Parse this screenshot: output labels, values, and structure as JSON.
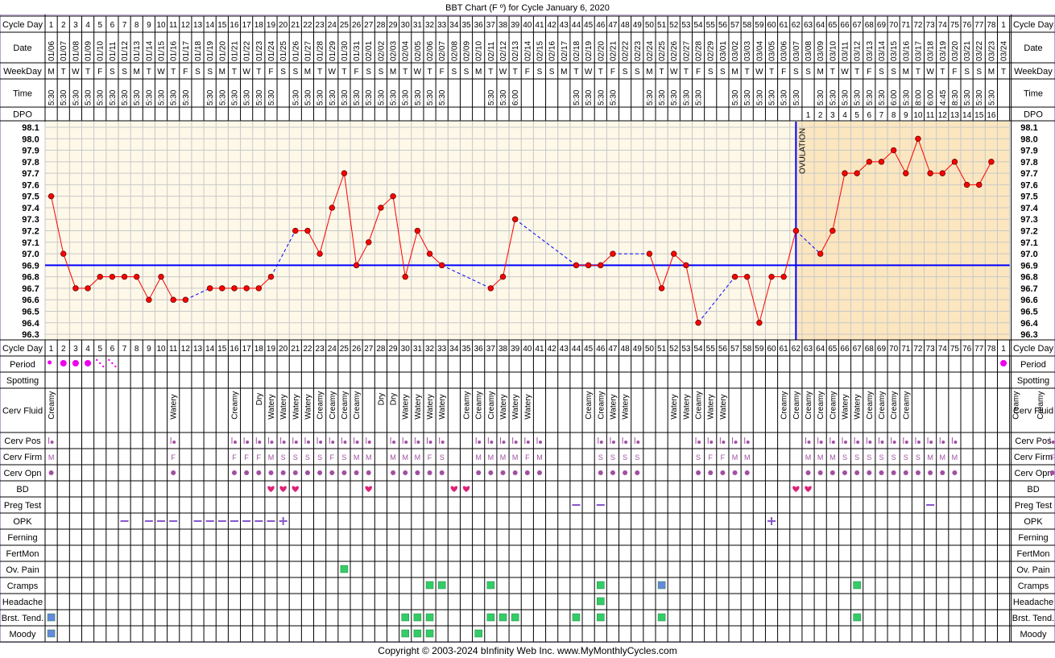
{
  "title": "BBT Chart (F º) for Cycle January 6, 2020",
  "footer": "Copyright © 2003-2024 bInfinity Web Inc.     www.MyMonthlyCycles.com",
  "colors": {
    "frame": "#b9a3d6",
    "chart_bg_pre": "#fdf8e8",
    "chart_bg_post": "#fbe6bf",
    "temp_line": "#ff0000",
    "coverline": "#0000ff",
    "period": "#ee00ee",
    "heart": "#dd2277",
    "symptom": "#33cc66",
    "symptom_alt": "#6688dd",
    "opk": "#8855cc",
    "cerv": "#a050a0"
  },
  "labels": {
    "cycle_day": "Cycle Day",
    "date": "Date",
    "weekday": "WeekDay",
    "time": "Time",
    "dpo": "DPO",
    "period": "Period",
    "spotting": "Spotting",
    "cerv_fluid": "Cerv Fluid",
    "cerv_pos": "Cerv Pos",
    "cerv_firm": "Cerv Firm",
    "cerv_opn": "Cerv Opn",
    "bd": "BD",
    "preg_test": "Preg Test",
    "opk": "OPK",
    "ferning": "Ferning",
    "fertmon": "FertMon",
    "ov_pain": "Ov. Pain",
    "cramps": "Cramps",
    "headache": "Headache",
    "brst_tend": "Brst. Tend.",
    "moody": "Moody",
    "ovulation": "OVULATION"
  },
  "chart_data": {
    "type": "line",
    "title": "BBT Chart (F º) for Cycle January 6, 2020",
    "xlabel": "Cycle Day",
    "ylabel": "",
    "ylim": [
      96.3,
      98.1
    ],
    "y_ticks": [
      "98.1",
      "98.0",
      "97.9",
      "97.8",
      "97.7",
      "97.6",
      "97.5",
      "97.4",
      "97.3",
      "97.2",
      "97.1",
      "97.0",
      "96.9",
      "96.8",
      "96.7",
      "96.6",
      "96.5",
      "96.4",
      "96.3"
    ],
    "grid": true,
    "cycle_days": [
      1,
      2,
      3,
      4,
      5,
      6,
      7,
      8,
      9,
      10,
      11,
      12,
      13,
      14,
      15,
      16,
      17,
      18,
      19,
      20,
      21,
      22,
      23,
      24,
      25,
      26,
      27,
      28,
      29,
      30,
      31,
      32,
      33,
      34,
      35,
      36,
      37,
      38,
      39,
      40,
      41,
      42,
      43,
      44,
      45,
      46,
      47,
      48,
      49,
      50,
      51,
      52,
      53,
      54,
      55,
      56,
      57,
      58,
      59,
      60,
      61,
      62,
      63,
      64,
      65,
      66,
      67,
      68,
      69,
      70,
      71,
      72,
      73,
      74,
      75,
      76,
      77,
      78
    ],
    "next_cycle_day": "1",
    "dates": [
      "01/06",
      "01/07",
      "01/08",
      "01/09",
      "01/10",
      "01/11",
      "01/12",
      "01/13",
      "01/14",
      "01/15",
      "01/16",
      "01/17",
      "01/18",
      "01/19",
      "01/20",
      "01/21",
      "01/22",
      "01/23",
      "01/24",
      "01/25",
      "01/26",
      "01/27",
      "01/28",
      "01/29",
      "01/30",
      "01/31",
      "02/01",
      "02/02",
      "02/03",
      "02/04",
      "02/05",
      "02/06",
      "02/07",
      "02/08",
      "02/09",
      "02/10",
      "02/11",
      "02/12",
      "02/13",
      "02/14",
      "02/15",
      "02/16",
      "02/17",
      "02/18",
      "02/19",
      "02/20",
      "02/21",
      "02/22",
      "02/23",
      "02/24",
      "02/25",
      "02/26",
      "02/27",
      "02/28",
      "02/29",
      "03/01",
      "03/02",
      "03/03",
      "03/04",
      "03/05",
      "03/06",
      "03/07",
      "03/08",
      "03/09",
      "03/10",
      "03/11",
      "03/12",
      "03/13",
      "03/14",
      "03/15",
      "03/16",
      "03/17",
      "03/18",
      "03/19",
      "03/20",
      "03/21",
      "03/22",
      "03/23",
      "03/24"
    ],
    "weekdays": [
      "M",
      "T",
      "W",
      "T",
      "F",
      "S",
      "S",
      "M",
      "T",
      "W",
      "T",
      "F",
      "S",
      "S",
      "M",
      "T",
      "W",
      "T",
      "F",
      "S",
      "S",
      "M",
      "T",
      "W",
      "T",
      "F",
      "S",
      "S",
      "M",
      "T",
      "W",
      "T",
      "F",
      "S",
      "S",
      "M",
      "T",
      "W",
      "T",
      "F",
      "S",
      "S",
      "M",
      "T",
      "W",
      "T",
      "F",
      "S",
      "S",
      "M",
      "T",
      "W",
      "T",
      "F",
      "S",
      "S",
      "M",
      "T",
      "W",
      "T",
      "F",
      "S",
      "S",
      "M",
      "T",
      "W",
      "T",
      "F",
      "S",
      "S",
      "M",
      "T",
      "W",
      "T",
      "F",
      "S",
      "S",
      "M",
      "T"
    ],
    "times": [
      "5:30",
      "5:30",
      "5:30",
      "5:30",
      "5:30",
      "5:30",
      "5:30",
      "5:30",
      "5:30",
      "5:30",
      "5:30",
      "5:30",
      "",
      "5:30",
      "5:30",
      "5:30",
      "5:30",
      "5:30",
      "5:30",
      "",
      "5:30",
      "5:30",
      "5:30",
      "5:30",
      "5:30",
      "5:30",
      "5:30",
      "5:30",
      "5:30",
      "5:30",
      "5:30",
      "5:30",
      "5:30",
      "",
      "",
      "",
      "5:30",
      "5:30",
      "6:00",
      "",
      "",
      "",
      "",
      "5:30",
      "5:30",
      "5:30",
      "5:30",
      "",
      "",
      "5:30",
      "5:30",
      "5:30",
      "5:30",
      "5:30",
      "",
      "",
      "5:30",
      "5:30",
      "5:30",
      "5:30",
      "5:30",
      "5:30",
      "",
      "5:30",
      "5:30",
      "5:30",
      "5:30",
      "5:30",
      "5:30",
      "6:00",
      "5:30",
      "8:00",
      "6:00",
      "4:45",
      "8:30",
      "5:30",
      "5:30",
      "5:30"
    ],
    "dpo": [
      "",
      "",
      "",
      "",
      "",
      "",
      "",
      "",
      "",
      "",
      "",
      "",
      "",
      "",
      "",
      "",
      "",
      "",
      "",
      "",
      "",
      "",
      "",
      "",
      "",
      "",
      "",
      "",
      "",
      "",
      "",
      "",
      "",
      "",
      "",
      "",
      "",
      "",
      "",
      "",
      "",
      "",
      "",
      "",
      "",
      "",
      "",
      "",
      "",
      "",
      "",
      "",
      "",
      "",
      "",
      "",
      "",
      "",
      "",
      "",
      "",
      "",
      "1",
      "2",
      "3",
      "4",
      "5",
      "6",
      "7",
      "8",
      "9",
      "10",
      "11",
      "12",
      "13",
      "14",
      "15",
      "16"
    ],
    "series": [
      {
        "values": [
          97.5,
          97.0,
          96.7,
          96.7,
          96.8,
          96.8,
          96.8,
          96.8,
          96.6,
          96.8,
          96.6,
          96.6,
          null,
          96.7,
          96.7,
          96.7,
          96.7,
          96.7,
          96.8,
          null,
          97.2,
          97.2,
          97.0,
          97.4,
          97.7,
          96.9,
          97.1,
          97.4,
          97.5,
          96.8,
          97.2,
          97.0,
          96.9,
          null,
          null,
          null,
          96.7,
          96.8,
          97.3,
          null,
          null,
          null,
          null,
          96.9,
          96.9,
          96.9,
          97.0,
          null,
          null,
          97.0,
          96.7,
          97.0,
          96.9,
          96.4,
          null,
          null,
          96.8,
          96.8,
          96.4,
          96.8,
          96.8,
          97.2,
          null,
          97.0,
          97.2,
          97.7,
          97.7,
          97.8,
          97.8,
          97.9,
          97.7,
          98.0,
          97.7,
          97.7,
          97.8,
          97.6,
          97.6,
          97.8
        ]
      }
    ],
    "coverline": 96.9,
    "ovulation_day": 62,
    "annotations": [
      "OVULATION"
    ]
  },
  "period": {
    "heavy": [
      2,
      3,
      4
    ],
    "light": [
      1
    ],
    "spotty": [
      5,
      6
    ]
  },
  "next_cycle_period": true,
  "cerv_fluid": [
    "Creamy",
    "",
    "",
    "",
    "",
    "",
    "",
    "",
    "",
    "",
    "Watery",
    "",
    "",
    "",
    "",
    "Creamy",
    "",
    "Dry",
    "Watery",
    "Watery",
    "Watery",
    "Watery",
    "Creamy",
    "Creamy",
    "Creamy",
    "Creamy",
    "",
    "Dry",
    "Dry",
    "Watery",
    "Watery",
    "Watery",
    "Watery",
    "",
    "Creamy",
    "Creamy",
    "Creamy",
    "Watery",
    "Watery",
    "Watery",
    "",
    "",
    "",
    "",
    "Creamy",
    "Creamy",
    "Watery",
    "Watery",
    "",
    "",
    "",
    "Watery",
    "Watery",
    "Creamy",
    "Watery",
    "Watery",
    "",
    "",
    "",
    "",
    "Creamy",
    "Creamy",
    "Creamy",
    "Creamy",
    "Creamy",
    "Watery",
    "Watery",
    "Creamy",
    "Creamy",
    "Creamy",
    "Creamy",
    "",
    "",
    "",
    "",
    "",
    "",
    "",
    "",
    "Creamy",
    "",
    "Creamy",
    "",
    "Creamy",
    "Creamy",
    "Creamy"
  ],
  "cerv_firm": [
    "M",
    "",
    "",
    "",
    "",
    "",
    "",
    "",
    "",
    "",
    "F",
    "",
    "",
    "",
    "",
    "F",
    "F",
    "F",
    "M",
    "S",
    "S",
    "S",
    "S",
    "F",
    "S",
    "M",
    "M",
    "",
    "M",
    "M",
    "M",
    "F",
    "S",
    "",
    "",
    "M",
    "M",
    "M",
    "M",
    "F",
    "M",
    "",
    "",
    "",
    "",
    "S",
    "S",
    "S",
    "S",
    "",
    "",
    "",
    "",
    "S",
    "F",
    "F",
    "M",
    "M",
    "",
    "",
    "",
    "",
    "M",
    "M",
    "M",
    "S",
    "S",
    "S",
    "S",
    "S",
    "S",
    "S",
    "M",
    "M",
    "M",
    "",
    "",
    "",
    "",
    "",
    "",
    "",
    "F",
    "",
    "F",
    "",
    "F",
    "F",
    "F"
  ],
  "bd_days": [
    19,
    20,
    21,
    27,
    34,
    35,
    62,
    63
  ],
  "preg_test_days": [
    44,
    46,
    73
  ],
  "opk_neg_days": [
    7,
    9,
    10,
    11,
    13,
    14,
    15,
    16,
    17,
    18,
    19
  ],
  "opk_pos_days": [
    20,
    60
  ],
  "ov_pain_days": [
    25
  ],
  "cramps_days": [
    32,
    33,
    37,
    46,
    67
  ],
  "cramps_alt_days": [
    51
  ],
  "headache_days": [
    46
  ],
  "brst_tend_days": [
    30,
    31,
    32,
    37,
    38,
    39,
    44,
    46,
    51,
    67
  ],
  "brst_tend_alt_days": [
    1
  ],
  "moody_days": [
    30,
    31,
    32,
    36
  ],
  "moody_alt_days": [
    1
  ]
}
